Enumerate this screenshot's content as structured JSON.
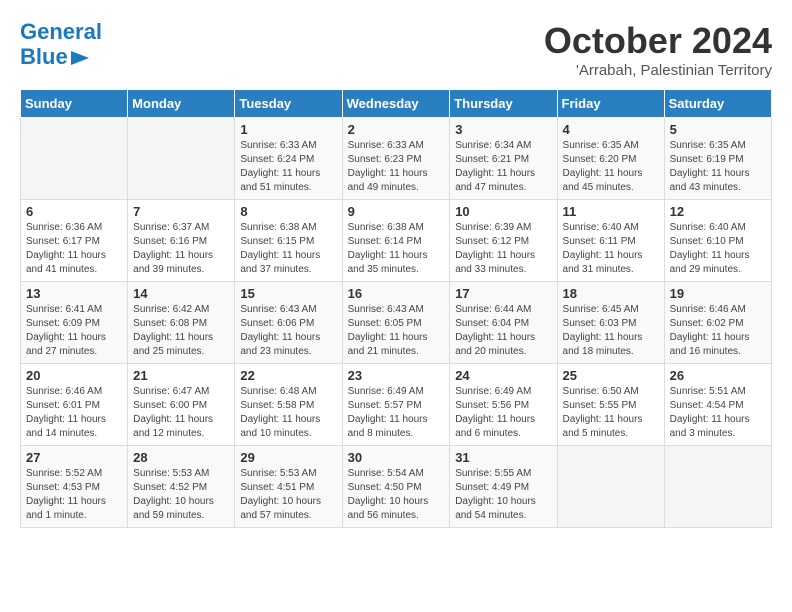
{
  "logo": {
    "line1": "General",
    "line2": "Blue"
  },
  "title": "October 2024",
  "subtitle": "'Arrabah, Palestinian Territory",
  "days_of_week": [
    "Sunday",
    "Monday",
    "Tuesday",
    "Wednesday",
    "Thursday",
    "Friday",
    "Saturday"
  ],
  "weeks": [
    [
      {
        "day": "",
        "sunrise": "",
        "sunset": "",
        "daylight": ""
      },
      {
        "day": "",
        "sunrise": "",
        "sunset": "",
        "daylight": ""
      },
      {
        "day": "1",
        "sunrise": "Sunrise: 6:33 AM",
        "sunset": "Sunset: 6:24 PM",
        "daylight": "Daylight: 11 hours and 51 minutes."
      },
      {
        "day": "2",
        "sunrise": "Sunrise: 6:33 AM",
        "sunset": "Sunset: 6:23 PM",
        "daylight": "Daylight: 11 hours and 49 minutes."
      },
      {
        "day": "3",
        "sunrise": "Sunrise: 6:34 AM",
        "sunset": "Sunset: 6:21 PM",
        "daylight": "Daylight: 11 hours and 47 minutes."
      },
      {
        "day": "4",
        "sunrise": "Sunrise: 6:35 AM",
        "sunset": "Sunset: 6:20 PM",
        "daylight": "Daylight: 11 hours and 45 minutes."
      },
      {
        "day": "5",
        "sunrise": "Sunrise: 6:35 AM",
        "sunset": "Sunset: 6:19 PM",
        "daylight": "Daylight: 11 hours and 43 minutes."
      }
    ],
    [
      {
        "day": "6",
        "sunrise": "Sunrise: 6:36 AM",
        "sunset": "Sunset: 6:17 PM",
        "daylight": "Daylight: 11 hours and 41 minutes."
      },
      {
        "day": "7",
        "sunrise": "Sunrise: 6:37 AM",
        "sunset": "Sunset: 6:16 PM",
        "daylight": "Daylight: 11 hours and 39 minutes."
      },
      {
        "day": "8",
        "sunrise": "Sunrise: 6:38 AM",
        "sunset": "Sunset: 6:15 PM",
        "daylight": "Daylight: 11 hours and 37 minutes."
      },
      {
        "day": "9",
        "sunrise": "Sunrise: 6:38 AM",
        "sunset": "Sunset: 6:14 PM",
        "daylight": "Daylight: 11 hours and 35 minutes."
      },
      {
        "day": "10",
        "sunrise": "Sunrise: 6:39 AM",
        "sunset": "Sunset: 6:12 PM",
        "daylight": "Daylight: 11 hours and 33 minutes."
      },
      {
        "day": "11",
        "sunrise": "Sunrise: 6:40 AM",
        "sunset": "Sunset: 6:11 PM",
        "daylight": "Daylight: 11 hours and 31 minutes."
      },
      {
        "day": "12",
        "sunrise": "Sunrise: 6:40 AM",
        "sunset": "Sunset: 6:10 PM",
        "daylight": "Daylight: 11 hours and 29 minutes."
      }
    ],
    [
      {
        "day": "13",
        "sunrise": "Sunrise: 6:41 AM",
        "sunset": "Sunset: 6:09 PM",
        "daylight": "Daylight: 11 hours and 27 minutes."
      },
      {
        "day": "14",
        "sunrise": "Sunrise: 6:42 AM",
        "sunset": "Sunset: 6:08 PM",
        "daylight": "Daylight: 11 hours and 25 minutes."
      },
      {
        "day": "15",
        "sunrise": "Sunrise: 6:43 AM",
        "sunset": "Sunset: 6:06 PM",
        "daylight": "Daylight: 11 hours and 23 minutes."
      },
      {
        "day": "16",
        "sunrise": "Sunrise: 6:43 AM",
        "sunset": "Sunset: 6:05 PM",
        "daylight": "Daylight: 11 hours and 21 minutes."
      },
      {
        "day": "17",
        "sunrise": "Sunrise: 6:44 AM",
        "sunset": "Sunset: 6:04 PM",
        "daylight": "Daylight: 11 hours and 20 minutes."
      },
      {
        "day": "18",
        "sunrise": "Sunrise: 6:45 AM",
        "sunset": "Sunset: 6:03 PM",
        "daylight": "Daylight: 11 hours and 18 minutes."
      },
      {
        "day": "19",
        "sunrise": "Sunrise: 6:46 AM",
        "sunset": "Sunset: 6:02 PM",
        "daylight": "Daylight: 11 hours and 16 minutes."
      }
    ],
    [
      {
        "day": "20",
        "sunrise": "Sunrise: 6:46 AM",
        "sunset": "Sunset: 6:01 PM",
        "daylight": "Daylight: 11 hours and 14 minutes."
      },
      {
        "day": "21",
        "sunrise": "Sunrise: 6:47 AM",
        "sunset": "Sunset: 6:00 PM",
        "daylight": "Daylight: 11 hours and 12 minutes."
      },
      {
        "day": "22",
        "sunrise": "Sunrise: 6:48 AM",
        "sunset": "Sunset: 5:58 PM",
        "daylight": "Daylight: 11 hours and 10 minutes."
      },
      {
        "day": "23",
        "sunrise": "Sunrise: 6:49 AM",
        "sunset": "Sunset: 5:57 PM",
        "daylight": "Daylight: 11 hours and 8 minutes."
      },
      {
        "day": "24",
        "sunrise": "Sunrise: 6:49 AM",
        "sunset": "Sunset: 5:56 PM",
        "daylight": "Daylight: 11 hours and 6 minutes."
      },
      {
        "day": "25",
        "sunrise": "Sunrise: 6:50 AM",
        "sunset": "Sunset: 5:55 PM",
        "daylight": "Daylight: 11 hours and 5 minutes."
      },
      {
        "day": "26",
        "sunrise": "Sunrise: 5:51 AM",
        "sunset": "Sunset: 4:54 PM",
        "daylight": "Daylight: 11 hours and 3 minutes."
      }
    ],
    [
      {
        "day": "27",
        "sunrise": "Sunrise: 5:52 AM",
        "sunset": "Sunset: 4:53 PM",
        "daylight": "Daylight: 11 hours and 1 minute."
      },
      {
        "day": "28",
        "sunrise": "Sunrise: 5:53 AM",
        "sunset": "Sunset: 4:52 PM",
        "daylight": "Daylight: 10 hours and 59 minutes."
      },
      {
        "day": "29",
        "sunrise": "Sunrise: 5:53 AM",
        "sunset": "Sunset: 4:51 PM",
        "daylight": "Daylight: 10 hours and 57 minutes."
      },
      {
        "day": "30",
        "sunrise": "Sunrise: 5:54 AM",
        "sunset": "Sunset: 4:50 PM",
        "daylight": "Daylight: 10 hours and 56 minutes."
      },
      {
        "day": "31",
        "sunrise": "Sunrise: 5:55 AM",
        "sunset": "Sunset: 4:49 PM",
        "daylight": "Daylight: 10 hours and 54 minutes."
      },
      {
        "day": "",
        "sunrise": "",
        "sunset": "",
        "daylight": ""
      },
      {
        "day": "",
        "sunrise": "",
        "sunset": "",
        "daylight": ""
      }
    ]
  ]
}
